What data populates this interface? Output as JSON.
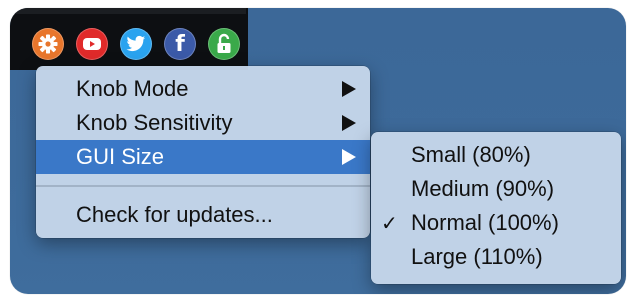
{
  "toolbar": {
    "icons": [
      {
        "name": "settings-gear-icon",
        "color": "#e8762c"
      },
      {
        "name": "youtube-icon",
        "color": "#e02a2a"
      },
      {
        "name": "twitter-icon",
        "color": "#2aa3ef"
      },
      {
        "name": "facebook-icon",
        "label": "f",
        "color": "#3b5aa8"
      },
      {
        "name": "unlock-icon",
        "color": "#3aa94a"
      }
    ]
  },
  "menu": {
    "items": [
      {
        "label": "Knob Mode",
        "has_submenu": true
      },
      {
        "label": "Knob Sensitivity",
        "has_submenu": true
      },
      {
        "label": "GUI Size",
        "has_submenu": true,
        "highlighted": true
      },
      {
        "label": "Check for updates...",
        "has_submenu": false
      }
    ],
    "highlight_color": "#3a78c8"
  },
  "submenu": {
    "items": [
      {
        "label": "Small (80%)",
        "checked": false
      },
      {
        "label": "Medium (90%)",
        "checked": false
      },
      {
        "label": "Normal (100%)",
        "checked": true
      },
      {
        "label": "Large (110%)",
        "checked": false
      }
    ],
    "check_mark": "✓"
  }
}
